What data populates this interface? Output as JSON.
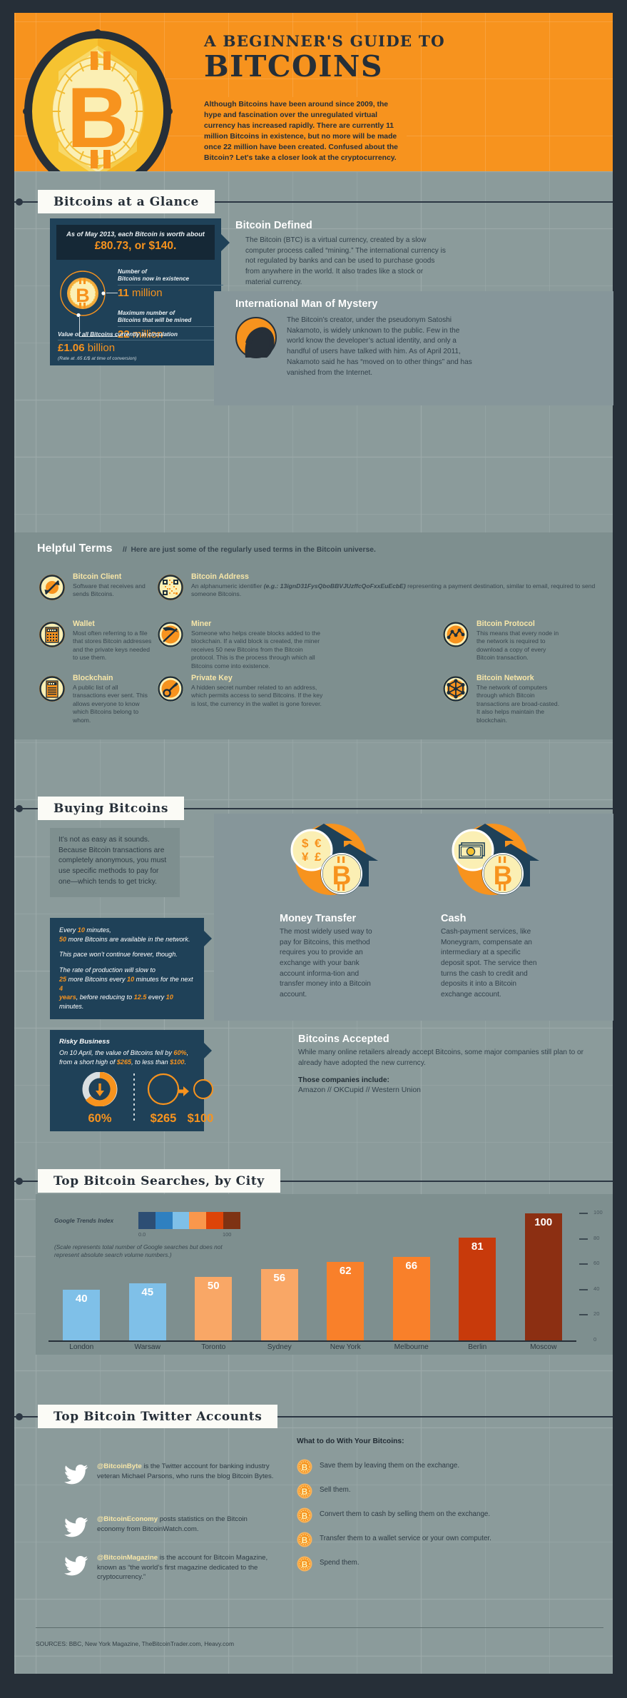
{
  "header": {
    "title_small": "A BEGINNER'S GUIDE TO",
    "title_big": "BITCOINS",
    "intro": "Although Bitcoins have been around since 2009, the hype and fascination over the unregulated virtual currency has increased rapidly. There are currently 11 million Bitcoins in existence, but no more will be made once 22 million have been created. Confused about the Bitcoin? Let's take a closer look at the cryptocurrency."
  },
  "sections": {
    "glance": "Bitcoins at a Glance",
    "buying": "Buying Bitcoins",
    "searches": "Top Bitcoin Searches, by City",
    "twitter": "Top Bitcoin Twitter Accounts"
  },
  "glance": {
    "quote_line": "As of May 2013, each Bitcoin is worth about",
    "quote_big": "£80.73, or $140.",
    "stat1_label": "Number of\nBitcoins now in existence",
    "stat1_num": "11",
    "stat1_unit": " million",
    "stat2_label": "Maximum number of\nBitcoins that will be mined",
    "stat2_num": "22",
    "stat2_unit": " million",
    "stat3_label": "Value of all Bitcoins currently in circulation",
    "stat3_num": "£1.06",
    "stat3_unit": " billion",
    "rate_note": "(Rate at .65 £/$ at time of conversion)"
  },
  "defined": {
    "heading": "Bitcoin Defined",
    "body": "The Bitcoin (BTC) is a virtual currency, created by a slow computer process called “mining.” The international currency is not regulated by banks and can be used to purchase goods from anywhere in the world. It also trades like a stock or material currency."
  },
  "mystery": {
    "heading": "International Man of Mystery",
    "body": "The Bitcoin’s creator, under the pseudonym Satoshi Nakamoto, is widely unknown to the public. Few in the world know the developer’s actual identity, and only a handful of users have talked with him. As of April 2011, Nakamoto said he has “moved on to other things” and has vanished from the Internet."
  },
  "terms": {
    "title": "Helpful Terms",
    "separator": "//",
    "subtitle": "Here are just some of the regularly used terms in the Bitcoin universe.",
    "items": [
      {
        "icon": "exchange-arrows-icon",
        "name": "Bitcoin Client",
        "desc": "Software that receives and sends Bitcoins."
      },
      {
        "icon": "qr-code-icon",
        "name": "Bitcoin Address",
        "desc_pre": "An alphanumeric identifier ",
        "desc_em": "(e.g.: 13ignD31FysQboBBVJUzffcQoFxxEuEcbE)",
        "desc_post": " representing a payment destination, similar to email, required to send someone Bitcoins."
      },
      {
        "icon": "wallet-icon",
        "name": "Wallet",
        "desc": "Most often referring to a file that stores Bitcoin addresses and the private keys needed to use them."
      },
      {
        "icon": "pickaxe-icon",
        "name": "Miner",
        "desc": "Someone who helps create blocks added to the blockchain. If a valid block is created, the miner receives 50 new Bitcoins from the Bitcoin protocol. This is the process through which all Bitcoins come into existence."
      },
      {
        "icon": "node-graph-icon",
        "name": "Bitcoin Protocol",
        "desc": "This means that every node in the network is required to download a copy of every Bitcoin transaction."
      },
      {
        "icon": "ledger-icon",
        "name": "Blockchain",
        "desc": "A public list of all transactions ever sent. This allows everyone to know which Bitcoins belong to whom."
      },
      {
        "icon": "key-icon",
        "name": "Private Key",
        "desc": "A hidden secret number related to an address, which permits access to send Bitcoins. If the key is lost, the currency in the wallet is gone forever."
      },
      {
        "icon": "network-mesh-icon",
        "name": "Bitcoin Network",
        "desc": "The network of computers through which Bitcoin transactions are broad-casted. It also helps maintain the blockchain."
      }
    ]
  },
  "buying": {
    "intro": "It’s not as easy as it sounds. Because Bitcoin transactions are completely anonymous, you must use specific methods to pay for one—which tends to get tricky.",
    "pace_l1a": "Every ",
    "pace_l1b": "10",
    "pace_l1c": " minutes,",
    "pace_l2a": "50",
    "pace_l2b": " more Bitcoins are available in the network.",
    "pace_l3": "This pace won’t continue forever, though.",
    "pace_l4": "The rate of production will slow to",
    "pace_l5a": "25",
    "pace_l5b": " more Bitcoins every ",
    "pace_l5c": "10",
    "pace_l5d": " minutes for the next ",
    "pace_l5e": "4",
    "pace_l6a": "years",
    "pace_l6b": ", before reducing to ",
    "pace_l6c": "12.5",
    "pace_l6d": " every ",
    "pace_l6e": "10",
    "pace_l6f": " minutes.",
    "risky_heading": "Risky Business",
    "risky_a": "On 10 April, the value of Bitcoins fell by ",
    "risky_pct": "60%",
    "risky_b": ", from a short high of ",
    "risky_high": "$265",
    "risky_c": ", to less than ",
    "risky_low": "$100",
    "risky_d": ".",
    "stat_pct": "60%",
    "stat_high": "$265",
    "stat_low": "$100",
    "methods": [
      {
        "icon": "currency-symbols-icon",
        "title": "Money Transfer",
        "body": "The most widely used way to pay for Bitcoins, this method requires you to provide an exchange with your bank account informa-tion and transfer money into a Bitcoin account."
      },
      {
        "icon": "banknote-icon",
        "title": "Cash",
        "body": "Cash-payment services, like Moneygram, compensate an intermediary at a specific deposit spot. The service then turns the cash to credit and deposits it into a Bitcoin exchange account."
      }
    ],
    "accepted_heading": "Bitcoins Accepted",
    "accepted_body": "While many online retailers already accept Bitcoins, some major companies still plan to or already have adopted the new currency.",
    "accepted_label": "Those companies include:",
    "accepted_companies": "Amazon  //  OKCupid  //  Western Union"
  },
  "chart_data": {
    "type": "bar",
    "title": "Top Bitcoin Searches, by City",
    "legend_label": "Google Trends Index",
    "legend_min": "0.0",
    "legend_max": "100",
    "legend_colors": [
      "#2d4e74",
      "#2f80c0",
      "#7fc0e8",
      "#f9974c",
      "#dd4408",
      "#7e3213"
    ],
    "note": "(Scale represents total number of Google searches but does not represent absolute search volume numbers.)",
    "categories": [
      "London",
      "Warsaw",
      "Toronto",
      "Sydney",
      "New York",
      "Melbourne",
      "Berlin",
      "Moscow"
    ],
    "values": [
      40,
      45,
      50,
      56,
      62,
      66,
      81,
      100
    ],
    "bar_colors": [
      "#7fc0e8",
      "#7fc0e8",
      "#f9a766",
      "#f9a766",
      "#f9802a",
      "#f9802a",
      "#c83a0b",
      "#8c2f12"
    ],
    "xlabel": "",
    "ylabel": "",
    "ylim": [
      0,
      100
    ],
    "yticks": [
      0,
      20,
      40,
      60,
      80,
      100
    ],
    "grid": false
  },
  "twitter": {
    "accounts": [
      {
        "icon": "twitter-bird-icon",
        "handle": "@BitcoinByte",
        "text": " is the Twitter account for banking industry veteran Michael Parsons, who runs the blog Bitcoin Bytes."
      },
      {
        "icon": "twitter-bird-icon",
        "handle": "@BitcoinEconomy",
        "text": " posts statistics on the Bitcoin economy from BitcoinWatch.com."
      },
      {
        "icon": "twitter-bird-icon",
        "handle": "@BitcoinMagazine",
        "text": " is the account for Bitcoin Magazine, known as “the world’s first magazine dedicated to the cryptocurrency.”"
      }
    ],
    "what_heading": "What to do With Your Bitcoins:",
    "what_items": [
      "Save them by leaving them on the exchange.",
      "Sell them.",
      "Convert them to cash by selling them on the exchange.",
      "Transfer them to a wallet service or your own computer.",
      "Spend them."
    ]
  },
  "footer": {
    "sources": "SOURCES: BBC, New York Magazine, TheBitcoinTrader.com, Heavy.com"
  },
  "colors": {
    "orange": "#f7931e",
    "navy": "#1f4158",
    "dark": "#262f38",
    "slate": "#8b9b9b",
    "cream": "#f7e6a8"
  }
}
